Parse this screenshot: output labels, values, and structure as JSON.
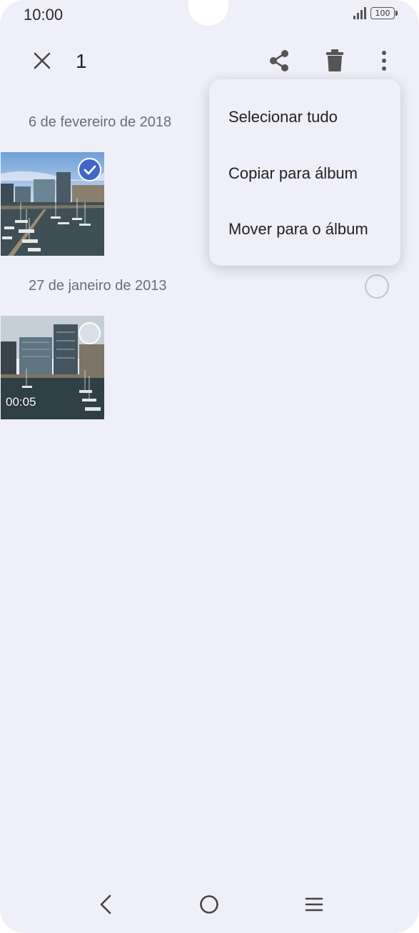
{
  "status_bar": {
    "time": "10:00",
    "battery": "100"
  },
  "toolbar": {
    "selected_count": "1",
    "icons": [
      "close-icon",
      "share-icon",
      "trash-icon",
      "more-vertical-icon"
    ]
  },
  "sections": [
    {
      "date": "6 de fevereiro de 2018",
      "items": [
        {
          "type": "photo",
          "selected": true
        }
      ]
    },
    {
      "date": "27 de janeiro de 2013",
      "items": [
        {
          "type": "video",
          "duration": "00:05",
          "selected": false
        }
      ]
    }
  ],
  "menu": {
    "items": [
      {
        "label": "Selecionar tudo"
      },
      {
        "label": "Copiar para álbum"
      },
      {
        "label": "Mover para o álbum"
      }
    ]
  },
  "nav_bar": {
    "icons": [
      "back-icon",
      "home-icon",
      "recent-apps-icon"
    ]
  },
  "colors": {
    "background": "#efeff9",
    "accent": "#4066c7"
  }
}
